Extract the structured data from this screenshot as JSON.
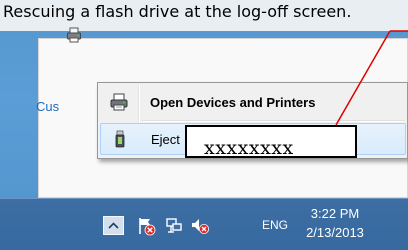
{
  "caption": {
    "text": "Rescuing a flash drive at the log-off screen."
  },
  "flyout": {
    "link_text": "Cus"
  },
  "context_menu": {
    "items": [
      {
        "label": "Open Devices and Printers",
        "icon": "devices-printer-icon",
        "bold": true
      },
      {
        "label": "Eject",
        "icon": "usb-drive-icon",
        "bold": false
      }
    ]
  },
  "annotation": {
    "redacted_text": "xxxxxxxx",
    "line_color": "#ff0000"
  },
  "taskbar": {
    "tray_icons": [
      "show-hidden-icons-chevron-icon",
      "action-center-flag-icon",
      "network-icon",
      "volume-muted-icon"
    ],
    "language": "ENG",
    "clock": {
      "time": "3:22 PM",
      "date": "2/13/2013"
    }
  },
  "colors": {
    "desktop": "#5b9dd6",
    "taskbar": "#3a6ca2",
    "menu_bg": "#f0f0f0",
    "menu_highlight": "#d9ebfb",
    "link": "#1e6ebf"
  }
}
